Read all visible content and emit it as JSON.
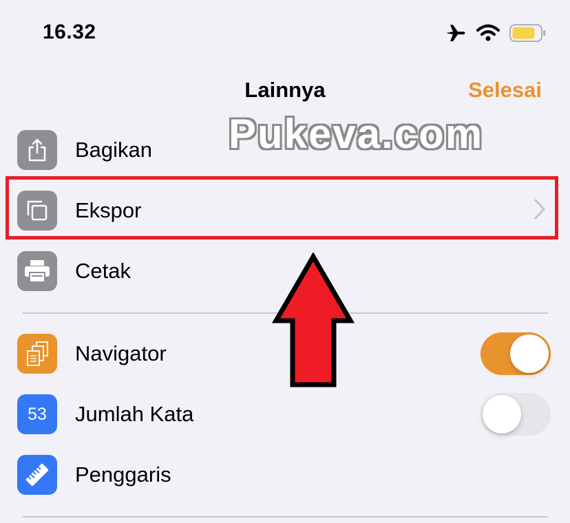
{
  "status_bar": {
    "time": "16.32",
    "icons": [
      "airplane-icon",
      "wifi-icon",
      "battery-icon"
    ],
    "battery_color": "#f5d246"
  },
  "nav": {
    "title": "Lainnya",
    "done_label": "Selesai",
    "accent_color": "#e8932e"
  },
  "watermark": "Pukeva.com",
  "menu": {
    "items": [
      {
        "label": "Bagikan",
        "icon": "share-icon",
        "icon_bg": "#8e8e93"
      },
      {
        "label": "Ekspor",
        "icon": "export-icon",
        "icon_bg": "#8e8e93",
        "has_chevron": true,
        "highlighted": true
      },
      {
        "label": "Cetak",
        "icon": "print-icon",
        "icon_bg": "#8e8e93"
      }
    ]
  },
  "options": {
    "items": [
      {
        "label": "Navigator",
        "icon": "pages-icon",
        "icon_bg": "#e8932e",
        "toggle": true
      },
      {
        "label": "Jumlah Kata",
        "icon": "word-count-icon",
        "icon_text": "53",
        "icon_bg": "#3478f6",
        "toggle": false
      },
      {
        "label": "Penggaris",
        "icon": "ruler-icon",
        "icon_bg": "#3478f6"
      }
    ]
  },
  "annotation": {
    "highlight_color": "#e3202a",
    "arrow_color": "#ee1c25"
  }
}
